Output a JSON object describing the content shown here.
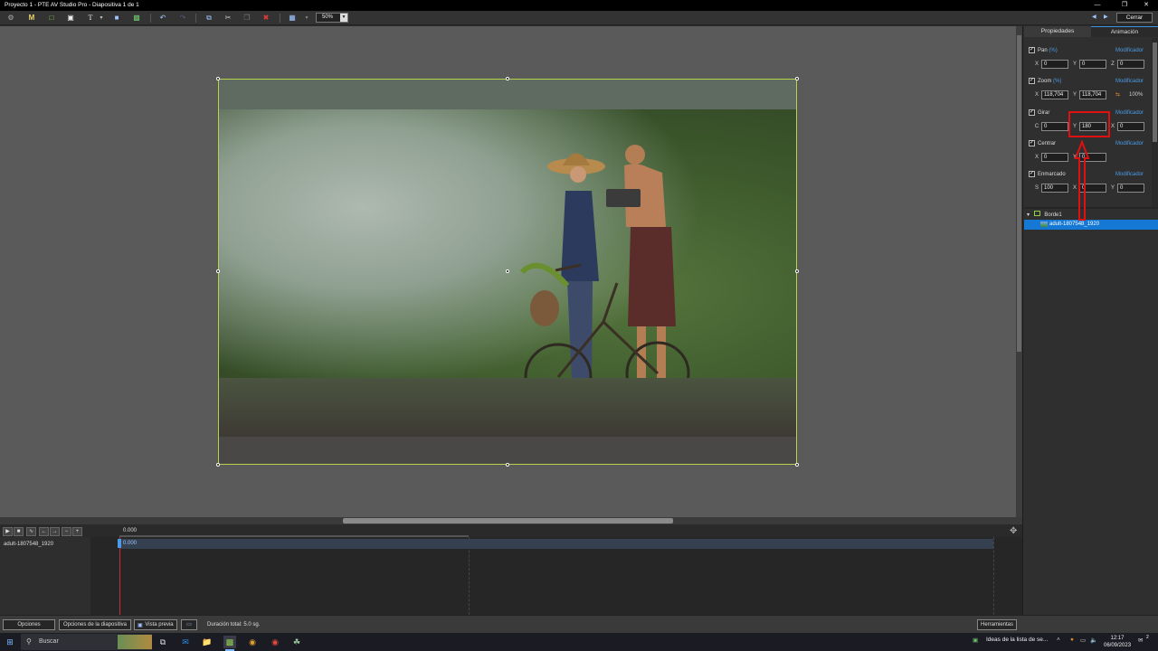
{
  "window": {
    "title": "Proyecto 1 - PTE AV Studio Pro - Diapositiva 1 de 1",
    "minimize": "—",
    "maximize": "❐",
    "close": "✕"
  },
  "toolbar": {
    "zoom_value": "50%",
    "close_label": "Cerrar"
  },
  "right_panel": {
    "tabs": [
      "Propiedades",
      "Animación"
    ],
    "modifier_label": "Modificador",
    "sections": {
      "pan": {
        "label": "Pan",
        "unit": "(%)",
        "x_label": "X",
        "y_label": "Y",
        "z_label": "Z",
        "x": "0",
        "y": "0",
        "z": "0"
      },
      "zoom": {
        "label": "Zoom",
        "unit": "(%)",
        "x_label": "X",
        "y_label": "Y",
        "x": "118,704",
        "y": "118,704",
        "extra": "100%"
      },
      "rotate": {
        "label": "Girar",
        "c_label": "C",
        "y_label": "Y",
        "x_label": "X",
        "c": "0",
        "y": "180",
        "x": "0"
      },
      "center": {
        "label": "Centrar",
        "x_label": "X",
        "y_label": "Y",
        "x": "0",
        "y": "0"
      },
      "framing": {
        "label": "Enmarcado",
        "s_label": "S",
        "x_label": "X",
        "y_label": "Y",
        "s": "100",
        "x": "0",
        "y": "0"
      }
    },
    "tree": {
      "parent": "Borde1",
      "child": "adult-1807548_1920"
    }
  },
  "timeline": {
    "start_time": "0.000",
    "track_name": "adult-1807548_1920",
    "clip_time": "0.000"
  },
  "bottom_bar": {
    "options": "Opciones",
    "slide_options": "Opciones de la diapositiva",
    "preview": "Vista previa",
    "duration": "Duración total: 5.0 sg.",
    "tools": "Herramientas"
  },
  "taskbar": {
    "search_placeholder": "Buscar",
    "notification": "Ideas de la lista de se...",
    "time": "12:17",
    "date": "06/09/2023",
    "notif_count": "2"
  }
}
